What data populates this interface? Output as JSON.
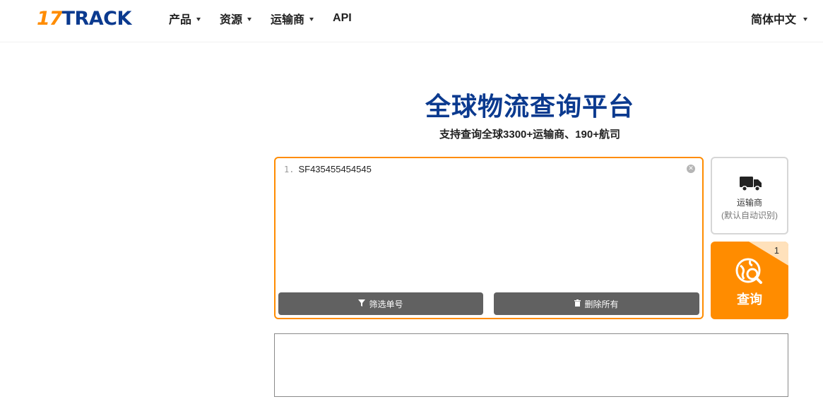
{
  "header": {
    "logo_num": "17",
    "logo_text": "TRACK",
    "nav": [
      {
        "label": "产品",
        "has_dropdown": true
      },
      {
        "label": "资源",
        "has_dropdown": true
      },
      {
        "label": "运输商",
        "has_dropdown": true
      },
      {
        "label": "API",
        "has_dropdown": false
      }
    ],
    "language": "简体中文"
  },
  "hero": {
    "title": "全球物流查询平台",
    "subtitle": "支持查询全球3300+运输商、190+航司"
  },
  "tracking_input": {
    "lines": [
      {
        "number": "1.",
        "value": "SF435455454545"
      }
    ],
    "filter_label": "筛选单号",
    "delete_label": "删除所有"
  },
  "carrier": {
    "label": "运输商",
    "sublabel": "(默认自动识别)",
    "icon": "truck-icon"
  },
  "search_button": {
    "label": "查询",
    "count": "1",
    "icon": "globe-search-icon"
  },
  "colors": {
    "accent": "#ff8c00",
    "brand_blue": "#0b3a8f",
    "button_gray": "#616161"
  }
}
